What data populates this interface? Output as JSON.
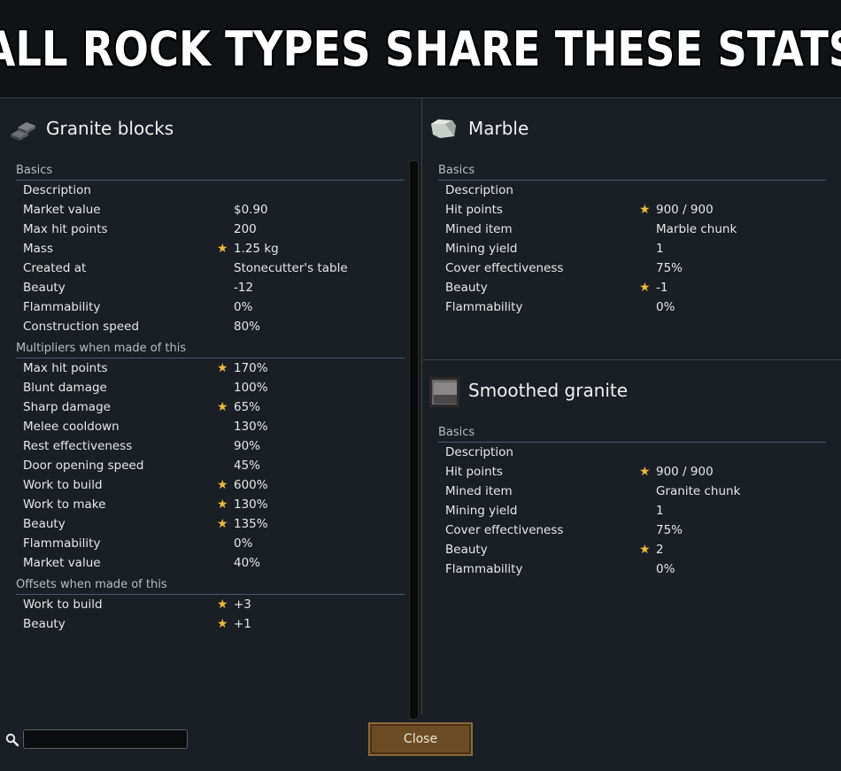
{
  "banner": {
    "text": "ALL ROCK TYPES SHARE THESE STATS"
  },
  "colors": {
    "star": "#f0b93a",
    "window_bg": "#1a1f25",
    "close_button": "#6b4c24"
  },
  "left_panel": {
    "title": "Granite blocks",
    "icon": "granite-blocks-icon",
    "sections": [
      {
        "label": "Basics",
        "rows": [
          {
            "label": "Description",
            "value": "",
            "star": false
          },
          {
            "label": "Market value",
            "value": "$0.90",
            "star": false
          },
          {
            "label": "Max hit points",
            "value": "200",
            "star": false
          },
          {
            "label": "Mass",
            "value": "1.25 kg",
            "star": true
          },
          {
            "label": "Created at",
            "value": "Stonecutter's table",
            "star": false
          },
          {
            "label": "Beauty",
            "value": "-12",
            "star": false
          },
          {
            "label": "Flammability",
            "value": "0%",
            "star": false
          },
          {
            "label": "Construction speed",
            "value": "80%",
            "star": false
          }
        ]
      },
      {
        "label": "Multipliers when made of this",
        "rows": [
          {
            "label": "Max hit points",
            "value": "170%",
            "star": true
          },
          {
            "label": "Blunt damage",
            "value": "100%",
            "star": false
          },
          {
            "label": "Sharp damage",
            "value": "65%",
            "star": true
          },
          {
            "label": "Melee cooldown",
            "value": "130%",
            "star": false
          },
          {
            "label": "Rest effectiveness",
            "value": "90%",
            "star": false
          },
          {
            "label": "Door opening speed",
            "value": "45%",
            "star": false
          },
          {
            "label": "Work to build",
            "value": "600%",
            "star": true
          },
          {
            "label": "Work to make",
            "value": "130%",
            "star": true
          },
          {
            "label": "Beauty",
            "value": "135%",
            "star": true
          },
          {
            "label": "Flammability",
            "value": "0%",
            "star": false
          },
          {
            "label": "Market value",
            "value": "40%",
            "star": false
          }
        ]
      },
      {
        "label": "Offsets when made of this",
        "rows": [
          {
            "label": "Work to build",
            "value": "+3",
            "star": true
          },
          {
            "label": "Beauty",
            "value": "+1",
            "star": true
          }
        ]
      }
    ]
  },
  "marble_panel": {
    "title": "Marble",
    "icon": "marble-icon",
    "section_label": "Basics",
    "rows": [
      {
        "label": "Description",
        "value": "",
        "star": false
      },
      {
        "label": "Hit points",
        "value": "900 / 900",
        "star": true
      },
      {
        "label": "Mined item",
        "value": "Marble chunk",
        "star": false
      },
      {
        "label": "Mining yield",
        "value": "1",
        "star": false
      },
      {
        "label": "Cover effectiveness",
        "value": "75%",
        "star": false
      },
      {
        "label": "Beauty",
        "value": "-1",
        "star": true
      },
      {
        "label": "Flammability",
        "value": "0%",
        "star": false
      }
    ]
  },
  "granite_panel": {
    "title": "Smoothed granite",
    "icon": "smoothed-granite-icon",
    "section_label": "Basics",
    "rows": [
      {
        "label": "Description",
        "value": "",
        "star": false
      },
      {
        "label": "Hit points",
        "value": "900 / 900",
        "star": true
      },
      {
        "label": "Mined item",
        "value": "Granite chunk",
        "star": false
      },
      {
        "label": "Mining yield",
        "value": "1",
        "star": false
      },
      {
        "label": "Cover effectiveness",
        "value": "75%",
        "star": false
      },
      {
        "label": "Beauty",
        "value": "2",
        "star": true
      },
      {
        "label": "Flammability",
        "value": "0%",
        "star": false
      }
    ]
  },
  "footer": {
    "search_value": "",
    "search_placeholder": "",
    "close_label": "Close"
  }
}
